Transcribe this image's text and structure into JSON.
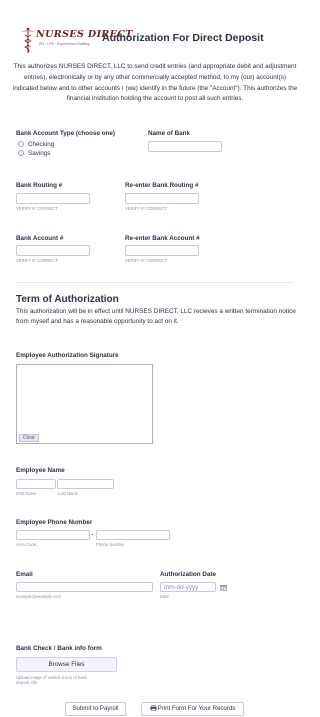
{
  "header": {
    "logo_text": "NURSES DIRECT",
    "logo_tagline": "RN · LPN · Experienced Staffing",
    "title": "Authorization For Direct Deposit"
  },
  "intro": "This authorizes NURSES DIRECT, LLC to send credit entries (and appropriate debit and adjustment entries), electronically or by any other commercially accepted method, to my (our) account(s) indicated below and to other accounts I (we) identify in the future (the \"Account\"). This authorizes the financial institution holding the account to post all such entries.",
  "account_type": {
    "label": "Bank Account Type (choose one)",
    "options": [
      "Checking",
      "Savings"
    ]
  },
  "bank_name": {
    "label": "Name of Bank"
  },
  "routing": {
    "label": "Bank Routing #",
    "sublabel": "VERIFY IF CORRECT"
  },
  "routing_confirm": {
    "label": "Re-enter Bank Routing #",
    "sublabel": "VERIFY IF CORRECT"
  },
  "account": {
    "label": "Bank Account #",
    "sublabel": "VERIFY IF CORRECT"
  },
  "account_confirm": {
    "label": "Re-enter Bank Account #",
    "sublabel": "VERIFY IF CORRECT"
  },
  "term": {
    "title": "Term of Authorization",
    "body": "This authorization will be in effect until NURSES DIRECT, LLC recieves a written termination notice from myself and has a reasonable opportunity to act on it."
  },
  "signature": {
    "label": "Employee Authorization Signature",
    "clear_label": "Clear"
  },
  "employee_name": {
    "label": "Employee Name",
    "first_sublabel": "First Name",
    "last_sublabel": "Last Name"
  },
  "phone": {
    "label": "Employee Phone Number",
    "area_sublabel": "Area Code",
    "number_sublabel": "Phone Number",
    "separator": "-"
  },
  "email": {
    "label": "Email",
    "sublabel": "example@example.com"
  },
  "auth_date": {
    "label": "Authorization Date",
    "placeholder": "mm-dd-yyyy",
    "sublabel": "Date"
  },
  "upload": {
    "label": "Bank Check / Bank info form",
    "button_label": "Browse Files",
    "sublabel_line1": "Upload image of voided check or bank",
    "sublabel_line2": "deposit info"
  },
  "actions": {
    "submit_label": "Submit to Payroll",
    "print_label": "Print Form For Your Records"
  },
  "colors": {
    "text": "#2c3345",
    "sublabel": "#8d8fa8",
    "logo": "#7a1f1f",
    "input_border": "#c3cad8"
  }
}
